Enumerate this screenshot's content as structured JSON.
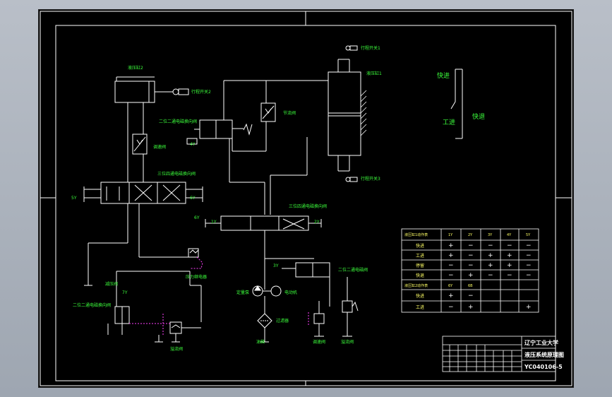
{
  "colors": {
    "line": "#ffffff",
    "label": "#3cff3c",
    "accent": "#ff40ff",
    "table_text": "#ffff66",
    "background": "#000000"
  },
  "labels": {
    "cylinder_2": "液压缸2",
    "cylinder_1": "液压缸1",
    "valve_22_top": "二位二通电磁换向阀",
    "throttle_top": "节流阀",
    "throttle_left": "调速阀",
    "valve_34_left": "三位四通电磁换向阀",
    "valve_34_mid": "三位四通电磁换向阀",
    "pressure_relay": "压力继电器",
    "relief_valve_right": "溢流阀",
    "valve_22_low_left": "二位二通电磁换向阀",
    "relief_valve_left": "溢流阀",
    "reducing_valve": "减压阀",
    "pump": "定量泵",
    "motor": "电动机",
    "filter": "过滤器",
    "tank": "油箱",
    "tank_bottom": "油箱",
    "valve_22_right": "二位二通电磁阀",
    "speed_valve_1": "调速阀",
    "speed_valve_2": "溢流阀",
    "limit_top": "行程开关1",
    "limit_mid": "行程开关2",
    "limit_low": "行程开关3",
    "sol_6y": "6Y",
    "sol_5y": "5Y",
    "sol_1y": "1Y",
    "sol_2y": "2Y",
    "sol_3y": "3Y",
    "sol_4y": "4Y",
    "sol_7y": "7Y",
    "sol_1ya": "6Y",
    "mode_fast_in": "快进",
    "mode_work": "工进",
    "mode_fast_back": "快退"
  },
  "table": {
    "headers": [
      "液压缸1动作表",
      "1Y",
      "2Y",
      "3Y",
      "4Y",
      "5Y"
    ],
    "rows": [
      [
        "快进",
        "+",
        "−",
        "−",
        "−",
        "−"
      ],
      [
        "工进",
        "+",
        "−",
        "+",
        "+",
        "−"
      ],
      [
        "停留",
        "−",
        "−",
        "+",
        "+",
        "−"
      ],
      [
        "快退",
        "−",
        "+",
        "−",
        "−",
        "−"
      ],
      [
        "液压缸2动作表",
        "6Y",
        "6B",
        "",
        "",
        ""
      ],
      [
        "快进",
        "+",
        "−",
        "",
        "",
        ""
      ],
      [
        "工进",
        "−",
        "+",
        "",
        "",
        "+"
      ]
    ]
  },
  "title_block": {
    "school": "辽宁工业大学",
    "drawing_name": "液压系统原理图",
    "drawing_no": "YC040106-5"
  }
}
